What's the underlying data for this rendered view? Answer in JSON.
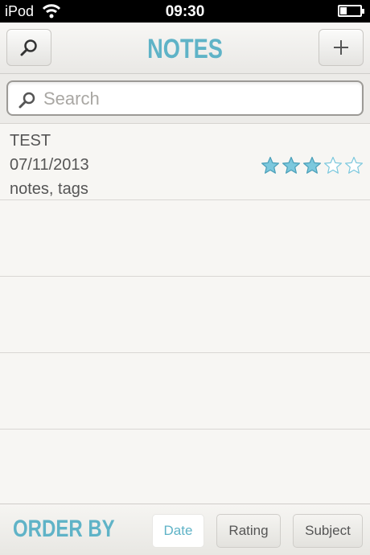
{
  "status_bar": {
    "carrier": "iPod",
    "time": "09:30"
  },
  "nav": {
    "title": "NOTES",
    "search_icon": "search-icon",
    "add_icon": "plus-icon"
  },
  "search": {
    "placeholder": "Search",
    "value": ""
  },
  "notes": [
    {
      "title": "TEST",
      "date": "07/11/2013",
      "tags": "notes, tags",
      "rating": 3,
      "max_rating": 5
    }
  ],
  "order_by": {
    "label": "ORDER BY",
    "options": [
      "Date",
      "Rating",
      "Subject"
    ],
    "selected": "Date"
  },
  "colors": {
    "accent": "#5fb3c7",
    "star": "#7cc8dd"
  }
}
